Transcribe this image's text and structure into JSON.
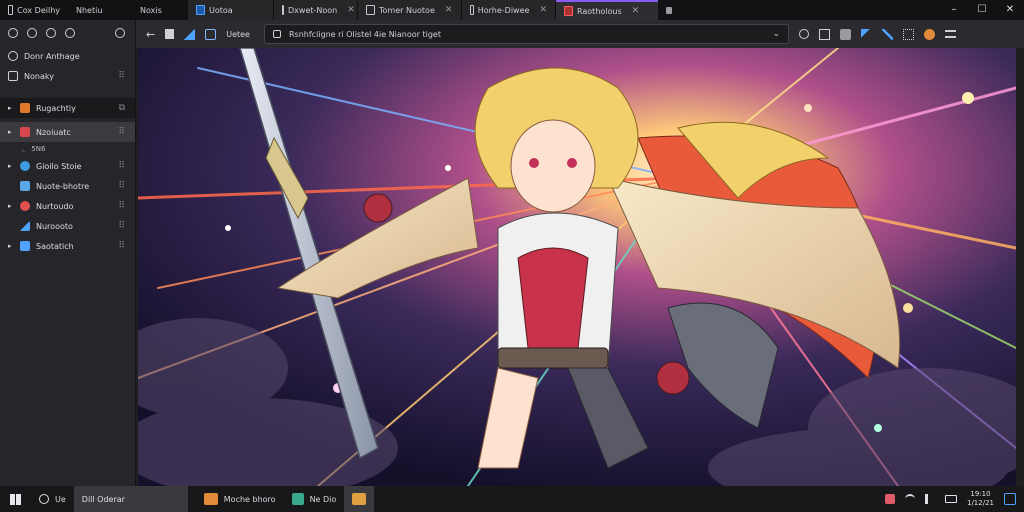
{
  "window": {
    "tabs": [
      {
        "label": "Cox Deilhy",
        "style": "plain"
      },
      {
        "label": "Nhetiu",
        "style": "plain"
      },
      {
        "label": "Noxis",
        "style": "plain"
      },
      {
        "label": "Uotoa",
        "style": "dark",
        "icon": "document-icon"
      },
      {
        "label": "Dxwet-Noon",
        "style": "dark",
        "icon": "document-icon"
      },
      {
        "label": "Tomer Nuotoe",
        "style": "dark",
        "icon": "document-icon"
      },
      {
        "label": "Horhe-Diwee",
        "style": "dark",
        "icon": "document-icon"
      },
      {
        "label": "Raotholous",
        "style": "active",
        "icon": "document-icon"
      }
    ],
    "controls": {
      "minimize": "–",
      "maximize": "☐",
      "close": "✕"
    }
  },
  "sidebar": {
    "items": [
      {
        "label": "Donr Anthage",
        "icon": "bookmark-icon",
        "dots": ""
      },
      {
        "label": "Nonaky",
        "icon": "monitor-icon",
        "dots": "⠿"
      },
      {
        "label": "Rugachtiy",
        "icon": "folder-icon",
        "dots": "⧉",
        "caret": "▸",
        "state": "highlight"
      },
      {
        "label": "Nzoiuatc",
        "icon": "image-icon",
        "dots": "⠿",
        "caret": "▸",
        "state": "selected"
      },
      {
        "label": "Gioilo Stoie",
        "icon": "globe-icon",
        "dots": "⠿",
        "caret": "▸"
      },
      {
        "label": "Nuote-bhotre",
        "icon": "film-icon",
        "dots": "⠿"
      },
      {
        "label": "Nurtoudo",
        "icon": "record-icon",
        "dots": "⠿",
        "caret": "▸"
      },
      {
        "label": "Nuroooto",
        "icon": "chart-icon",
        "dots": "⠿"
      },
      {
        "label": "Saotatich",
        "icon": "archive-icon",
        "dots": "⠿",
        "caret": "▸"
      }
    ],
    "subitem": "5N6"
  },
  "navbar": {
    "back": "←",
    "tab_label": "Uetee",
    "address": "Rsnhfcligne ri Olistel  4ie Nianoor tiget",
    "dropdown": "⌄"
  },
  "taskbar": {
    "search_prefix": "Ue",
    "search_text": "Dill Oderar",
    "apps": [
      {
        "label": "Moche bhoro",
        "icon": "app-orange-icon"
      },
      {
        "label": "Ne Dio",
        "icon": "app-teal-icon"
      }
    ],
    "clock_time": "19:10",
    "clock_date": "1/12/21"
  },
  "colors": {
    "accent": "#8a5cf6",
    "cape": "#e85a3a",
    "hair": "#f2d06b",
    "armor": "#c8324a"
  }
}
